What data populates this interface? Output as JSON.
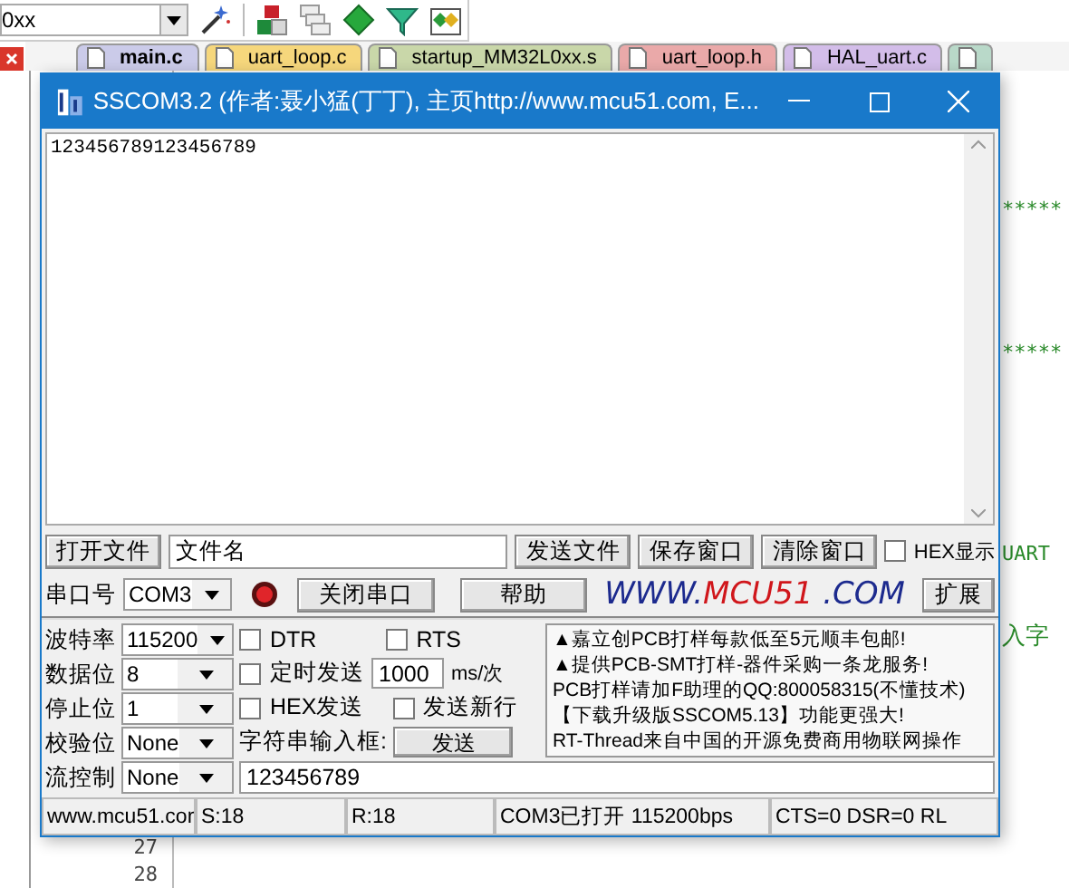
{
  "ide": {
    "toolbar": {
      "device_combo": "0xx"
    },
    "tabs": [
      {
        "label": "main.c",
        "color": "#cbcbe9",
        "selected": true
      },
      {
        "label": "uart_loop.c",
        "color": "#f6d77c",
        "selected": false
      },
      {
        "label": "startup_MM32L0xx.s",
        "color": "#c9d7a9",
        "selected": false
      },
      {
        "label": "uart_loop.h",
        "color": "#eaa9a9",
        "selected": false
      },
      {
        "label": "HAL_uart.c",
        "color": "#d3bde9",
        "selected": false
      },
      {
        "color": "#b9d9c9",
        "selected": false
      }
    ],
    "code_fragments": [
      "*****",
      "*****",
      "UART",
      "入字"
    ],
    "line_numbers": [
      "27",
      "28"
    ]
  },
  "window": {
    "title": "SSCOM3.2 (作者:聂小猛(丁丁), 主页http://www.mcu51.com,  E...",
    "receive_text": "123456789123456789",
    "file_row": {
      "open_button": "打开文件",
      "file_name": "文件名",
      "send_file_button": "发送文件",
      "save_button": "保存窗口",
      "clear_button": "清除窗口",
      "hex_display": {
        "label": "HEX显示",
        "checked": false
      }
    },
    "port_row": {
      "label": "串口号",
      "port": "COM3",
      "port_open": true,
      "close_button": "关闭串口",
      "help_button": "帮助",
      "expand_button": "扩展",
      "logo": [
        {
          "text": "WWW.",
          "color": "#1c2a8e"
        },
        {
          "text": "MCU51",
          "color": "#d0161b"
        },
        {
          "text": " .COM",
          "color": "#1c2a8e"
        }
      ]
    },
    "settings": [
      {
        "label": "波特率",
        "value": "115200"
      },
      {
        "label": "数据位",
        "value": "8"
      },
      {
        "label": "停止位",
        "value": "1"
      },
      {
        "label": "校验位",
        "value": "None"
      },
      {
        "label": "流控制",
        "value": "None"
      }
    ],
    "options": [
      {
        "label": "DTR",
        "checked": false
      },
      {
        "label": "RTS",
        "checked": false
      },
      {
        "label": "定时发送",
        "checked": false
      },
      {
        "label": "HEX发送",
        "checked": false
      },
      {
        "label": "发送新行",
        "checked": false
      }
    ],
    "interval": "1000",
    "interval_unit": "ms/次",
    "input_label": "字符串输入框:",
    "send_button": "发送",
    "send_text": "123456789",
    "ads": [
      "▲嘉立创PCB打样每款低至5元顺丰包邮!",
      "▲提供PCB-SMT打样-器件采购一条龙服务!",
      "PCB打样请加F助理的QQ:800058315(不懂技术)",
      "【下载升级版SSCOM5.13】功能更强大!",
      "RT-Thread来自中国的开源免费商用物联网操作"
    ],
    "status_bar": [
      "www.mcu51.cor",
      "S:18",
      "R:18",
      "COM3已打开  115200bps",
      "CTS=0 DSR=0 RL"
    ]
  }
}
